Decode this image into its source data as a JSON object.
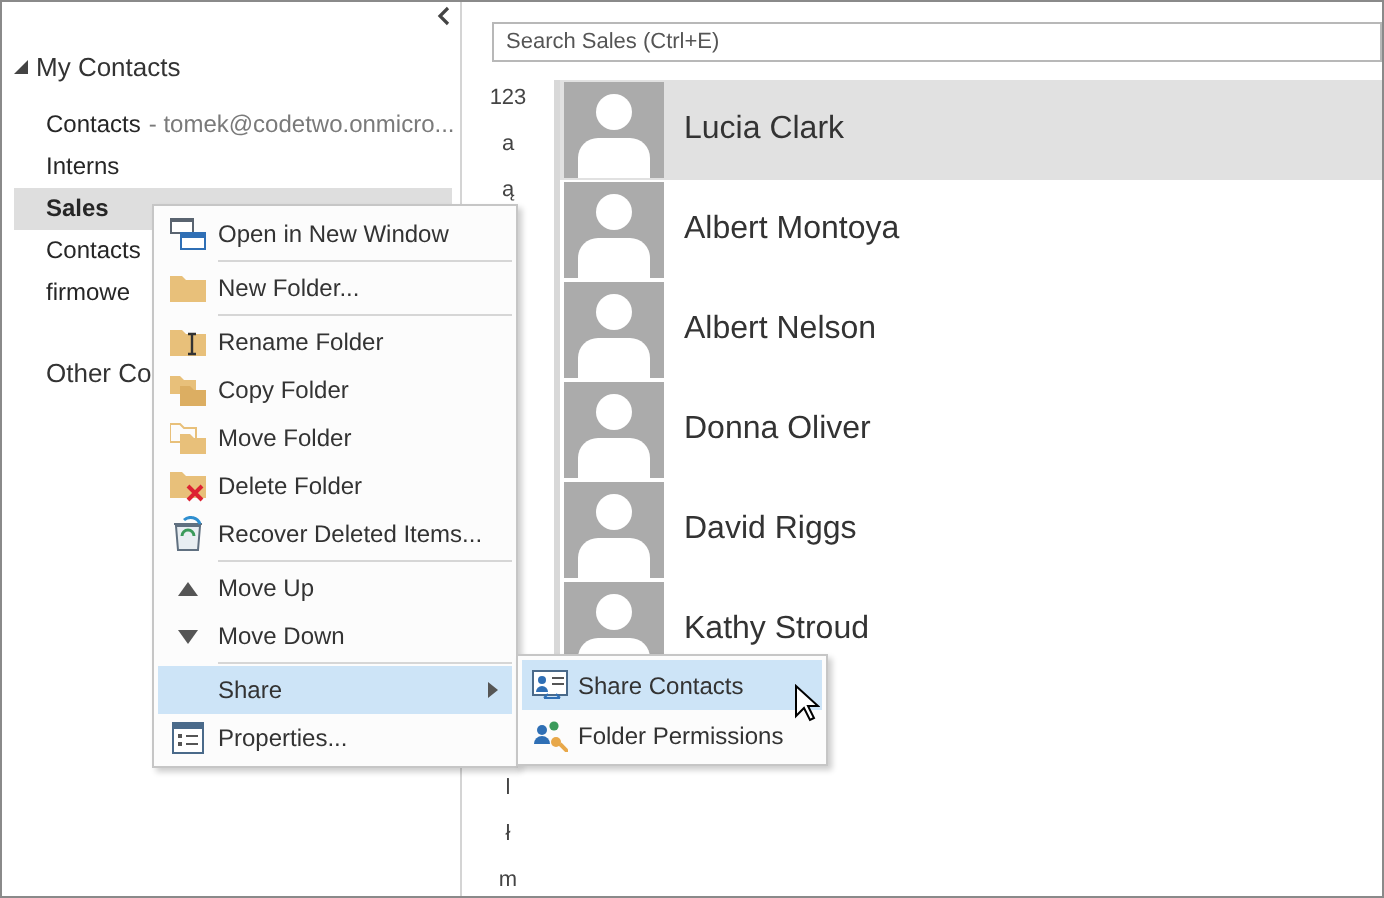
{
  "folder_pane": {
    "group": {
      "label": "My Contacts",
      "expanded": true
    },
    "folders": [
      {
        "name": "Contacts",
        "suffix": "- tomek@codetwo.onmicro...",
        "selected": false
      },
      {
        "name": "Interns",
        "selected": false
      },
      {
        "name": "Sales",
        "selected": true
      },
      {
        "name": "Contacts",
        "selected": false
      },
      {
        "name": "firmowe",
        "selected": false
      }
    ],
    "other_group": {
      "label": "Other Co"
    }
  },
  "search": {
    "placeholder": "Search Sales (Ctrl+E)"
  },
  "letter_index": [
    "123",
    "a",
    "ą"
  ],
  "letter_index_tail": [
    "l",
    "ł",
    "m"
  ],
  "contacts": [
    {
      "name": "Lucia Clark",
      "selected": true
    },
    {
      "name": "Albert Montoya",
      "selected": false
    },
    {
      "name": "Albert Nelson",
      "selected": false
    },
    {
      "name": "Donna Oliver",
      "selected": false
    },
    {
      "name": "David Riggs",
      "selected": false
    },
    {
      "name": "Kathy Stroud",
      "selected": false
    }
  ],
  "context_menu": [
    {
      "label": "Open in New Window",
      "selected": false,
      "separator_before": false
    },
    {
      "label": "New Folder...",
      "selected": false,
      "separator_before": true
    },
    {
      "label": "Rename Folder",
      "selected": false,
      "separator_before": true
    },
    {
      "label": "Copy Folder",
      "selected": false,
      "separator_before": false
    },
    {
      "label": "Move Folder",
      "selected": false,
      "separator_before": false
    },
    {
      "label": "Delete Folder",
      "selected": false,
      "separator_before": false
    },
    {
      "label": "Recover Deleted Items...",
      "selected": false,
      "separator_before": false
    },
    {
      "label": "Move Up",
      "selected": false,
      "separator_before": true
    },
    {
      "label": "Move Down",
      "selected": false,
      "separator_before": false
    },
    {
      "label": "Share",
      "selected": true,
      "separator_before": true,
      "submenu": true
    },
    {
      "label": "Properties...",
      "selected": false,
      "separator_before": false
    }
  ],
  "share_submenu": [
    {
      "label": "Share Contacts",
      "selected": true
    },
    {
      "label": "Folder Permissions",
      "selected": false
    }
  ]
}
